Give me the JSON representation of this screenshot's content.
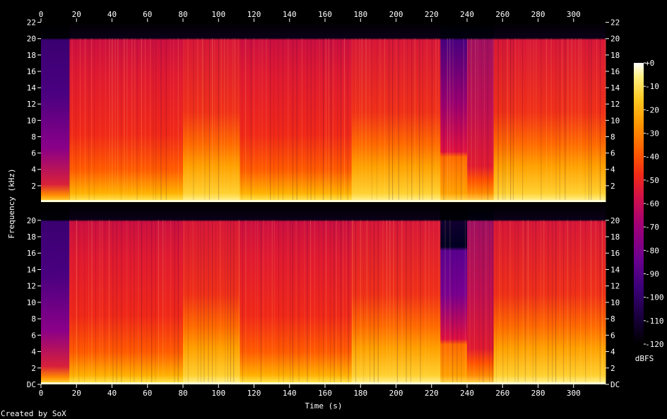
{
  "chart_data": {
    "type": "heatmap",
    "title": "",
    "xlabel": "Time (s)",
    "ylabel": "Frequency (kHz)",
    "xlim": [
      0,
      318
    ],
    "ylim": [
      0,
      22.05
    ],
    "x_ticks": [
      0,
      20,
      40,
      60,
      80,
      100,
      120,
      140,
      160,
      180,
      200,
      220,
      240,
      260,
      280,
      300
    ],
    "x_tick_labels": [
      "0",
      "20",
      "40",
      "60",
      "80",
      "100",
      "120",
      "140",
      "160",
      "180",
      "200",
      "220",
      "240",
      "260",
      "280",
      "300"
    ],
    "channels": [
      {
        "y_ticks": [
          2,
          4,
          6,
          8,
          10,
          12,
          14,
          16,
          18,
          20,
          22
        ],
        "y_tick_labels": [
          "2",
          "4",
          "6",
          "8",
          "10",
          "12",
          "14",
          "16",
          "18",
          "20",
          "22"
        ],
        "segments": [
          {
            "t0": 0,
            "t1": 16,
            "profile": "quiet"
          },
          {
            "t0": 16,
            "t1": 80,
            "profile": "loud"
          },
          {
            "t0": 80,
            "t1": 112,
            "profile": "bright"
          },
          {
            "t0": 112,
            "t1": 175,
            "profile": "loud"
          },
          {
            "t0": 175,
            "t1": 225,
            "profile": "bright"
          },
          {
            "t0": 225,
            "t1": 240,
            "profile": "lowpass_mid"
          },
          {
            "t0": 240,
            "t1": 255,
            "profile": "lowpass_low"
          },
          {
            "t0": 255,
            "t1": 318,
            "profile": "bright"
          }
        ]
      },
      {
        "y_ticks": [
          0,
          2,
          4,
          6,
          8,
          10,
          12,
          14,
          16,
          18,
          20
        ],
        "y_tick_labels": [
          "DC",
          "2",
          "4",
          "6",
          "8",
          "10",
          "12",
          "14",
          "16",
          "18",
          "20"
        ],
        "segments": [
          {
            "t0": 0,
            "t1": 16,
            "profile": "quiet"
          },
          {
            "t0": 16,
            "t1": 80,
            "profile": "loud"
          },
          {
            "t0": 80,
            "t1": 112,
            "profile": "bright"
          },
          {
            "t0": 112,
            "t1": 175,
            "profile": "loud"
          },
          {
            "t0": 175,
            "t1": 225,
            "profile": "bright"
          },
          {
            "t0": 225,
            "t1": 240,
            "profile": "dark_top"
          },
          {
            "t0": 240,
            "t1": 255,
            "profile": "lowpass_low"
          },
          {
            "t0": 255,
            "t1": 318,
            "profile": "bright"
          }
        ]
      }
    ],
    "colorbar": {
      "label": "dBFS",
      "range": [
        -120,
        0
      ],
      "ticks": [
        "+0",
        "-10",
        "-20",
        "-30",
        "-40",
        "-50",
        "-60",
        "-70",
        "-80",
        "-90",
        "-100",
        "-110",
        "-120"
      ]
    },
    "colormap": [
      "#000000",
      "#1a0040",
      "#3b0078",
      "#6a0090",
      "#a00078",
      "#d0104a",
      "#f02a18",
      "#ff5a00",
      "#ff9400",
      "#ffc820",
      "#fff080",
      "#ffffff"
    ]
  },
  "footer": {
    "credit": "Created by SoX"
  }
}
